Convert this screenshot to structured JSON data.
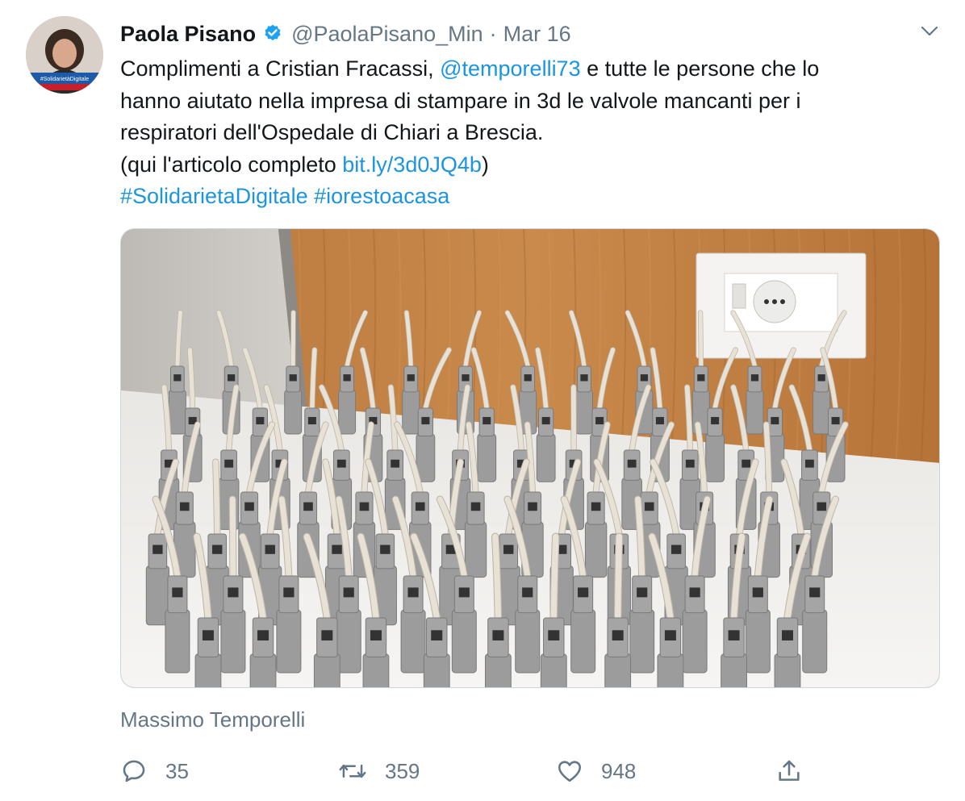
{
  "author": {
    "display_name": "Paola Pisano",
    "handle": "@PaolaPisano_Min",
    "separator": "·",
    "date": "Mar 16",
    "verified": true,
    "avatar_badge_text": "#SolidarietàDigitale"
  },
  "tweet": {
    "text_1": "Complimenti a Cristian Fracassi, ",
    "mention": "@temporelli73",
    "text_2": "  e tutte le persone che lo",
    "line_2": "hanno aiutato nella impresa di stampare in 3d le valvole mancanti per i",
    "line_3": "respiratori dell'Ospedale di Chiari a Brescia.",
    "line_4_pre": "(qui l'articolo completo ",
    "url": "bit.ly/3d0JQ4b",
    "line_4_post": ")",
    "hashtag_1": "#SolidarietaDigitale",
    "hashtag_2": "#iorestoacasa"
  },
  "media": {
    "description_icon": "photo-3d-printed-valves"
  },
  "photo_credit": "Massimo Temporelli",
  "actions": {
    "reply_count": "35",
    "retweet_count": "359",
    "like_count": "948"
  },
  "colors": {
    "link": "#1b95e0",
    "secondary_text": "#657786",
    "verified": "#1da1f2"
  }
}
